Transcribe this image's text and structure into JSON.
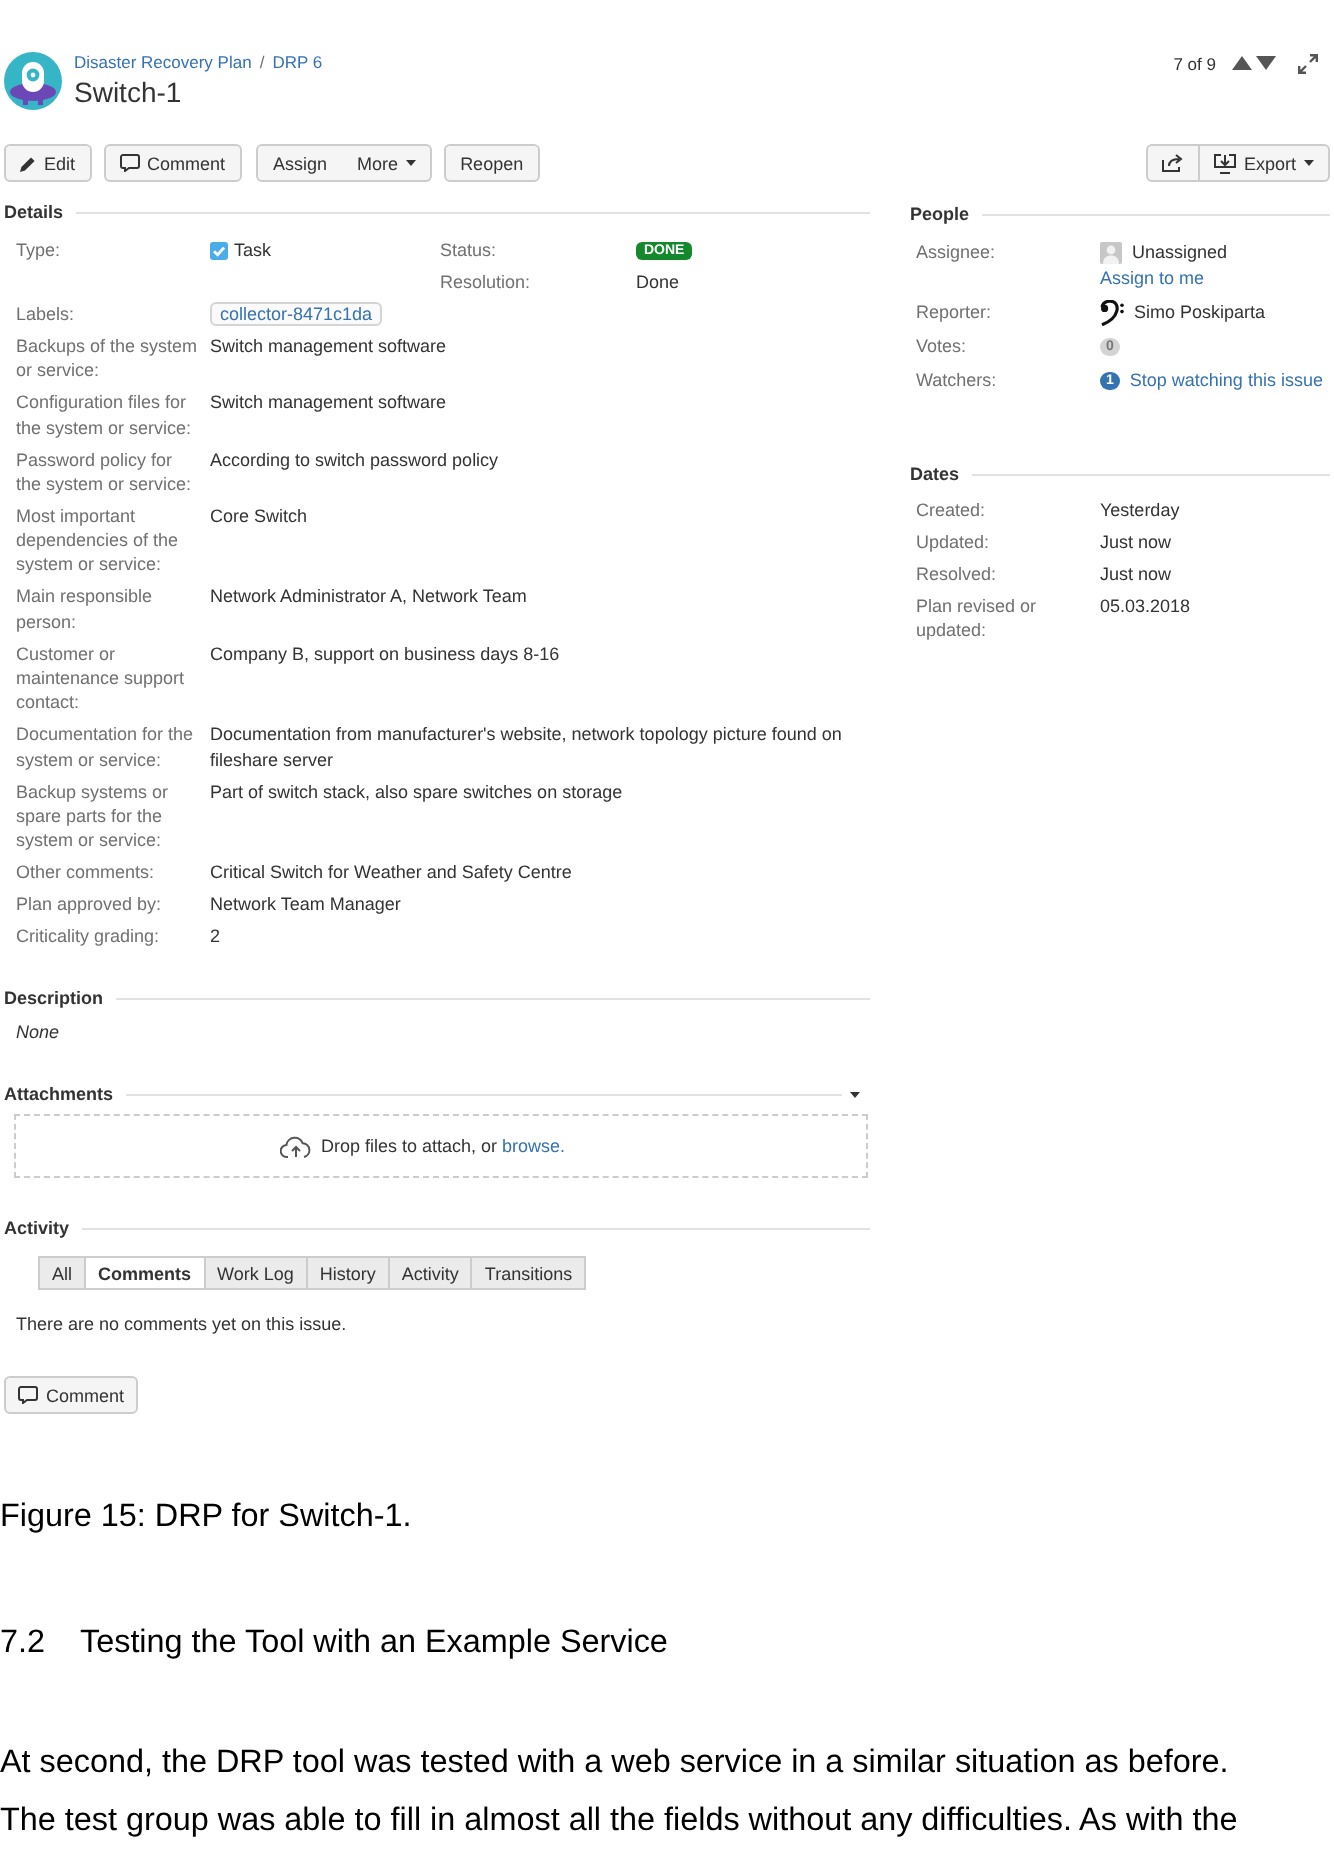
{
  "header": {
    "breadcrumbs": [
      {
        "label": "Disaster Recovery Plan"
      },
      {
        "label": "DRP 6"
      }
    ],
    "separator": "/",
    "title": "Switch-1",
    "pager": "7 of 9"
  },
  "toolbar": {
    "edit": "Edit",
    "comment": "Comment",
    "assign": "Assign",
    "more": "More",
    "reopen": "Reopen",
    "export": "Export"
  },
  "details": {
    "heading": "Details",
    "type": {
      "label": "Type:",
      "value": "Task"
    },
    "status": {
      "label": "Status:",
      "value": "DONE"
    },
    "resolution": {
      "label": "Resolution:",
      "value": "Done"
    },
    "labels": {
      "label": "Labels:",
      "values": [
        "collector-8471c1da"
      ]
    },
    "fields": [
      {
        "label": "Backups of the system or service:",
        "value": "Switch management software"
      },
      {
        "label": "Configuration files for the system or service:",
        "value": "Switch management software"
      },
      {
        "label": "Password policy for the system or service:",
        "value": "According to switch password policy"
      },
      {
        "label": "Most important dependencies of the system or service:",
        "value": "Core Switch"
      },
      {
        "label": "Main responsible person:",
        "value": "Network Administrator A, Network Team"
      },
      {
        "label": "Customer or maintenance support contact:",
        "value": "Company B, support on business days 8-16"
      },
      {
        "label": "Documentation for the system or service:",
        "value": "Documentation from manufacturer's website, network topology picture found on fileshare server"
      },
      {
        "label": "Backup systems or spare parts for the system or service:",
        "value": "Part of switch stack, also spare switches on storage"
      },
      {
        "label": "Other comments:",
        "value": "Critical Switch for Weather and Safety Centre"
      },
      {
        "label": "Plan approved by:",
        "value": "Network Team Manager"
      },
      {
        "label": "Criticality grading:",
        "value": "2"
      }
    ]
  },
  "people": {
    "heading": "People",
    "assignee": {
      "label": "Assignee:",
      "value": "Unassigned",
      "action": "Assign to me"
    },
    "reporter": {
      "label": "Reporter:",
      "value": "Simo Poskiparta"
    },
    "votes": {
      "label": "Votes:",
      "count": "0",
      "voted": false
    },
    "watchers": {
      "label": "Watchers:",
      "count": "1",
      "watching": true,
      "action": "Stop watching this issue"
    }
  },
  "dates": {
    "heading": "Dates",
    "items": [
      {
        "label": "Created:",
        "value": "Yesterday"
      },
      {
        "label": "Updated:",
        "value": "Just now"
      },
      {
        "label": "Resolved:",
        "value": "Just now"
      },
      {
        "label": "Plan revised or updated:",
        "value": "05.03.2018"
      }
    ]
  },
  "description": {
    "heading": "Description",
    "value": "None"
  },
  "attachments": {
    "heading": "Attachments",
    "prompt": "Drop files to attach, or",
    "link": "browse."
  },
  "activity": {
    "heading": "Activity",
    "tabs": [
      {
        "label": "All",
        "selected": false
      },
      {
        "label": "Comments",
        "selected": true
      },
      {
        "label": "Work Log",
        "selected": false
      },
      {
        "label": "History",
        "selected": false
      },
      {
        "label": "Activity",
        "selected": false
      },
      {
        "label": "Transitions",
        "selected": false
      }
    ],
    "message": "There are no comments yet on this issue.",
    "button": "Comment"
  },
  "document": {
    "caption": "Figure 15: DRP for Switch-1.",
    "section": {
      "number": "7.2",
      "title": "Testing the Tool with an Example Service"
    },
    "paragraph": "At second, the DRP tool was tested with a web service in a similar situation as before. The test group was able to fill in almost all the fields without any difficulties. As with the"
  }
}
